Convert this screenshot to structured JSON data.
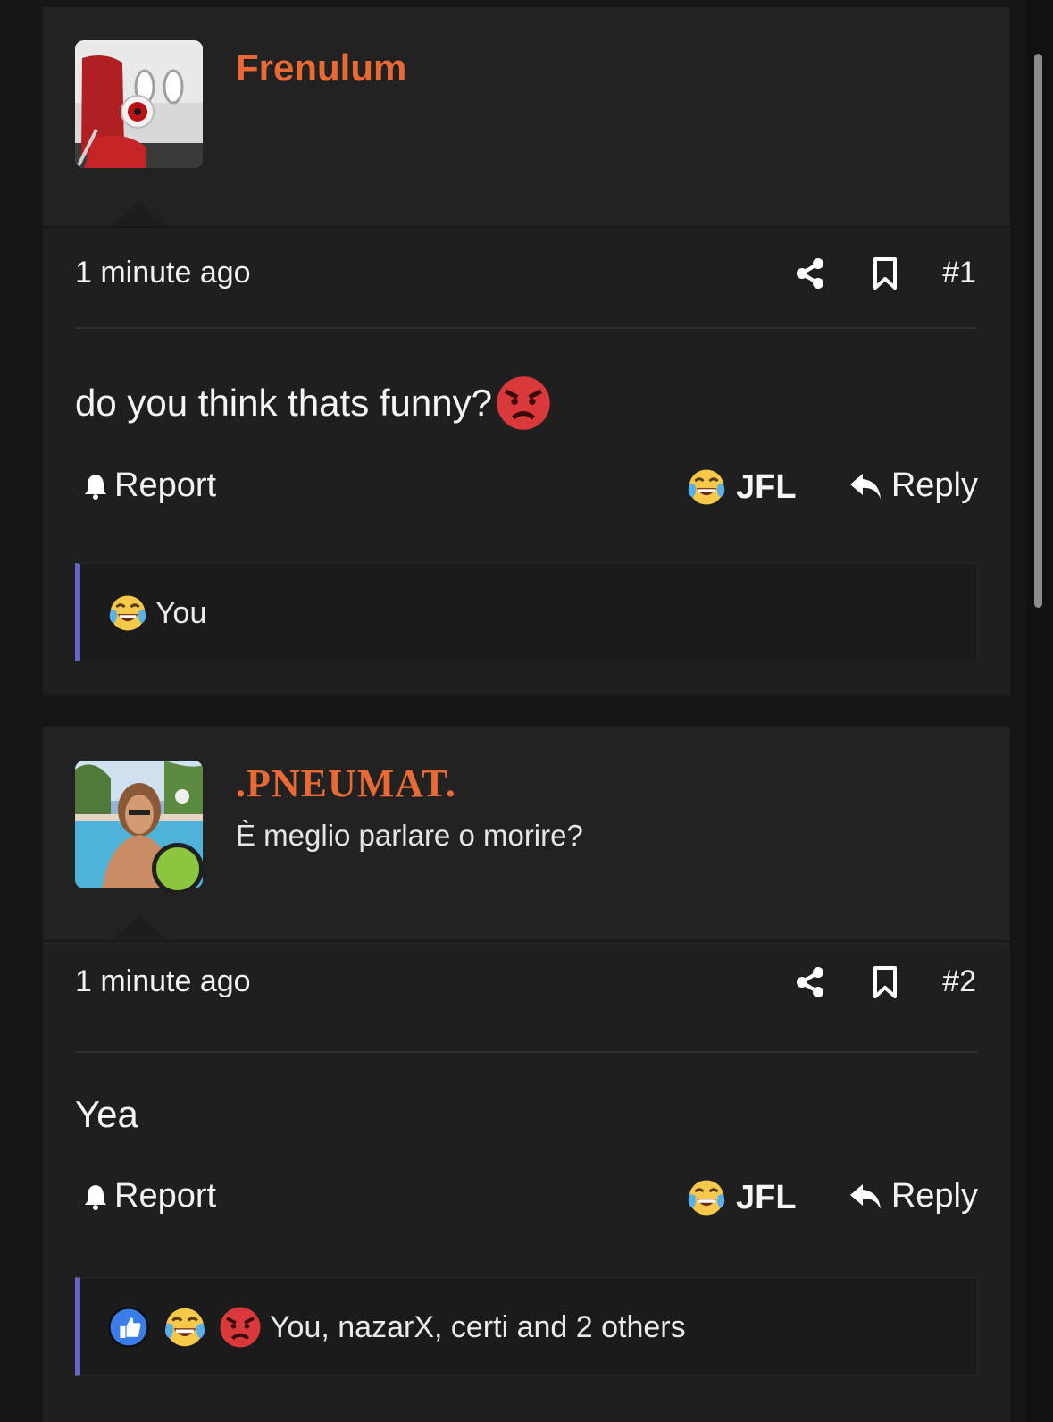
{
  "colors": {
    "accent": "#ea6a35",
    "online": "#8cc63f",
    "reaction_bar": "#6466c8"
  },
  "posts": [
    {
      "username": "Frenulum",
      "user_title": "",
      "time": "1 minute ago",
      "number": "#1",
      "body": "do you think thats funny?",
      "body_emoji": "angry-face",
      "report_label": "Report",
      "jfl_label": "JFL",
      "reply_label": "Reply",
      "reactions": [
        "laughing-crying"
      ],
      "reactions_text": "You"
    },
    {
      "username": ".PNEUMAT.",
      "user_title": "È meglio parlare o morire?",
      "online": true,
      "time": "1 minute ago",
      "number": "#2",
      "body": "Yea",
      "report_label": "Report",
      "jfl_label": "JFL",
      "reply_label": "Reply",
      "reactions": [
        "thumbs-up",
        "laughing-crying",
        "angry-face"
      ],
      "reactions_text": "You, nazarX, certi and 2 others"
    }
  ]
}
